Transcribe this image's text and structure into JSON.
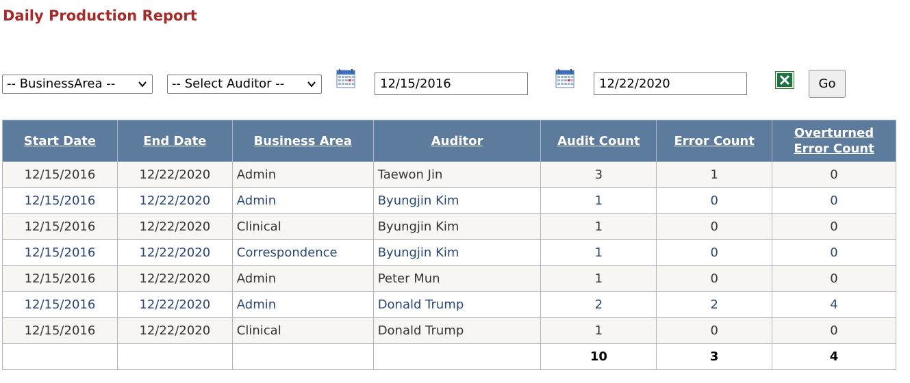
{
  "title": "Daily Production Report",
  "filters": {
    "business_area": "-- BusinessArea --",
    "auditor": "-- Select Auditor --",
    "start_date": "12/15/2016",
    "end_date": "12/22/2020",
    "go_label": "Go"
  },
  "icons": {
    "calendar": "calendar-icon",
    "export": "excel-export-icon",
    "dropdown": "chevron-down-icon"
  },
  "colors": {
    "title": "#a52a2a",
    "header_bg": "#5d7b9d",
    "row_alt_bg": "#f7f6f3",
    "link_text": "#284775"
  },
  "table": {
    "headers": [
      "Start Date",
      "End Date",
      "Business Area",
      "Auditor",
      "Audit Count",
      "Error Count",
      "Overturned Error Count"
    ],
    "rows": [
      [
        "12/15/2016",
        "12/22/2020",
        "Admin",
        "Taewon Jin",
        "3",
        "1",
        "0"
      ],
      [
        "12/15/2016",
        "12/22/2020",
        "Admin",
        "Byungjin Kim",
        "1",
        "0",
        "0"
      ],
      [
        "12/15/2016",
        "12/22/2020",
        "Clinical",
        "Byungjin Kim",
        "1",
        "0",
        "0"
      ],
      [
        "12/15/2016",
        "12/22/2020",
        "Correspondence",
        "Byungjin Kim",
        "1",
        "0",
        "0"
      ],
      [
        "12/15/2016",
        "12/22/2020",
        "Admin",
        "Peter Mun",
        "1",
        "0",
        "0"
      ],
      [
        "12/15/2016",
        "12/22/2020",
        "Admin",
        "Donald Trump",
        "2",
        "2",
        "4"
      ],
      [
        "12/15/2016",
        "12/22/2020",
        "Clinical",
        "Donald Trump",
        "1",
        "0",
        "0"
      ]
    ],
    "totals": [
      "",
      "",
      "",
      "",
      "10",
      "3",
      "4"
    ]
  }
}
